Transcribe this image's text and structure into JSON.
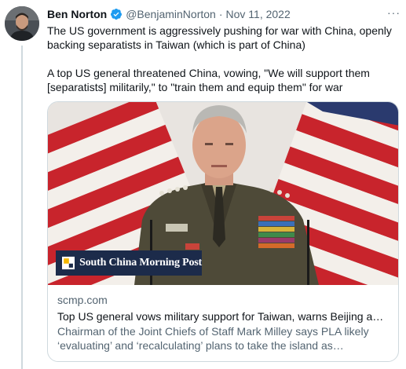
{
  "author": {
    "name": "Ben Norton",
    "handle": "@BenjaminNorton",
    "separator": "·",
    "date": "Nov 11, 2022",
    "verified_color": "#1d9bf0",
    "avatar": "profile-photo"
  },
  "more_menu": {
    "label": "···",
    "icon": "more-horizontal-icon"
  },
  "tweet": {
    "paragraph_1": "The US government is aggressively pushing for war with China, openly backing separatists in Taiwan (which is part of China)",
    "paragraph_2": "A top US general threatened China, vowing, \"We will support them [separatists] militarily,\" to \"train them and equip them\" for war"
  },
  "card": {
    "image": "photo-of-general-in-front-of-us-flags",
    "source_logo_text": "South China Morning Post",
    "domain": "scmp.com",
    "title": "Top US general vows military support for Taiwan, warns Beijing against attack",
    "description": "Chairman of the Joint Chiefs of Staff Mark Milley says PLA likely ‘evaluating’ and ‘recalculating’ plans to take the island as amphibious assault would be ‘very difficult’."
  },
  "colors": {
    "text_primary": "#0f1419",
    "text_secondary": "#536471",
    "border": "#cfd9de",
    "accent": "#1d9bf0"
  }
}
